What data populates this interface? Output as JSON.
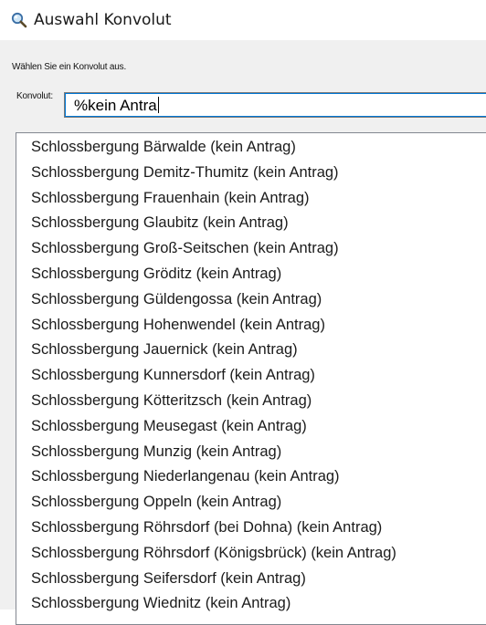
{
  "window": {
    "title": "Auswahl Konvolut",
    "icon": "magnifier-icon"
  },
  "dialog": {
    "instruction": "Wählen Sie ein Konvolut aus.",
    "konvolut_label": "Konvolut:",
    "konvolut_value": "%kein Antra"
  },
  "list": {
    "items": [
      "Schlossbergung Bärwalde (kein Antrag)",
      "Schlossbergung Demitz-Thumitz (kein Antrag)",
      "Schlossbergung Frauenhain (kein Antrag)",
      "Schlossbergung Glaubitz (kein Antrag)",
      "Schlossbergung Groß-Seitschen (kein Antrag)",
      "Schlossbergung Gröditz (kein Antrag)",
      "Schlossbergung Güldengossa (kein Antrag)",
      "Schlossbergung Hohenwendel (kein Antrag)",
      "Schlossbergung Jauernick (kein Antrag)",
      "Schlossbergung Kunnersdorf (kein Antrag)",
      "Schlossbergung Kötteritzsch (kein Antrag)",
      "Schlossbergung Meusegast (kein Antrag)",
      "Schlossbergung Munzig (kein Antrag)",
      "Schlossbergung Niederlangenau (kein Antrag)",
      "Schlossbergung Oppeln (kein Antrag)",
      "Schlossbergung Röhrsdorf (bei Dohna) (kein Antrag)",
      "Schlossbergung Röhrsdorf (Königsbrück) (kein Antrag)",
      "Schlossbergung Seifersdorf (kein Antrag)",
      "Schlossbergung Wiednitz (kein Antrag)"
    ]
  }
}
